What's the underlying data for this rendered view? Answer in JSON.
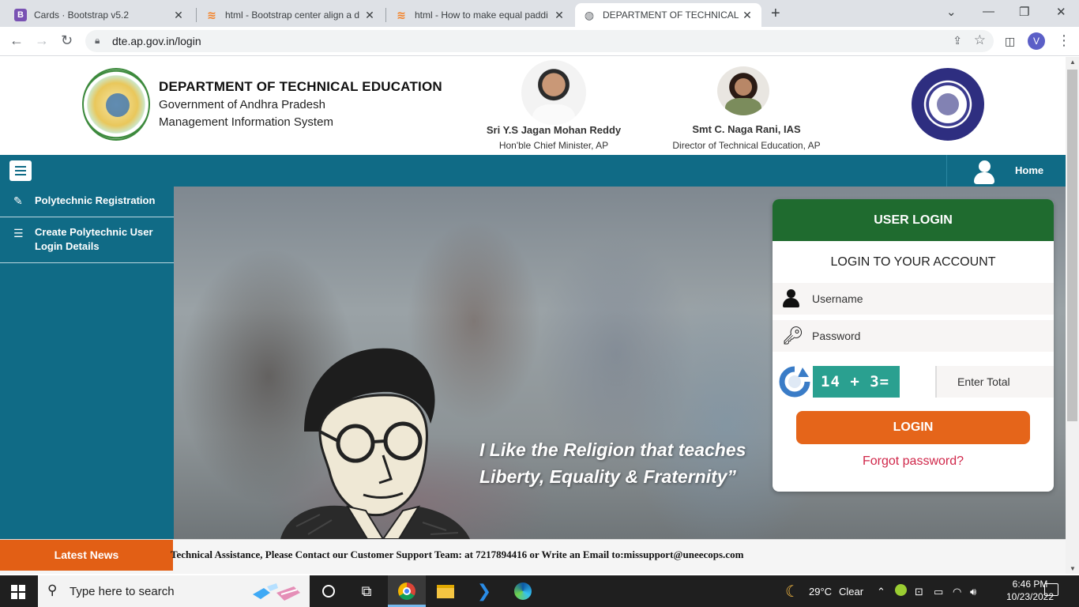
{
  "browser": {
    "tabs": [
      {
        "title": "Cards · Bootstrap v5.2",
        "favicon": "bootstrap-icon",
        "favicon_letter": "B",
        "active": false
      },
      {
        "title": "html - Bootstrap center align a d",
        "favicon": "stackoverflow-icon",
        "active": false
      },
      {
        "title": "html - How to make equal paddi",
        "favicon": "stackoverflow-icon",
        "active": false
      },
      {
        "title": "DEPARTMENT OF TECHNICAL ED",
        "favicon": "globe-icon",
        "active": true
      }
    ],
    "url": "dte.ap.gov.in/login",
    "profile_initial": "V"
  },
  "header": {
    "title": "DEPARTMENT OF TECHNICAL EDUCATION",
    "subtitle1": "Government of Andhra Pradesh",
    "subtitle2": "Management Information System",
    "cm_name": "Sri Y.S Jagan Mohan Reddy",
    "cm_role": "Hon'ble Chief Minister, AP",
    "director_name": "Smt C. Naga Rani, IAS",
    "director_role": "Director of Technical Education, AP"
  },
  "nav": {
    "home_label": "Home"
  },
  "sidebar": {
    "items": [
      {
        "label": "Polytechnic Registration",
        "icon": "edit-icon"
      },
      {
        "label": "Create Polytechnic User Login Details",
        "icon": "list-icon"
      }
    ]
  },
  "hero": {
    "quote": "I Like the Religion that teaches Liberty, Equality & Fraternity”"
  },
  "login": {
    "header": "USER LOGIN",
    "subtitle": "LOGIN TO YOUR ACCOUNT",
    "username_placeholder": "Username",
    "password_placeholder": "Password",
    "captcha": "14 + 3=",
    "total_placeholder": "Enter Total",
    "login_button": "LOGIN",
    "forgot_link": "Forgot password?"
  },
  "news": {
    "label": "Latest News",
    "ticker": "Technical Assistance, Please Contact our Customer Support Team: at 7217894416 or Write an Email to:missupport@uneecops.com"
  },
  "taskbar": {
    "search_placeholder": "Type here to search",
    "weather_temp": "29°C",
    "weather_text": "Clear",
    "time": "6:46 PM",
    "date": "10/23/2022"
  },
  "colors": {
    "nav_teal": "#106b86",
    "login_green": "#1f6b2f",
    "login_button_orange": "#e5651a",
    "news_orange": "#e25f15",
    "forgot_red": "#d0274a",
    "captcha_teal": "#2aa090"
  }
}
